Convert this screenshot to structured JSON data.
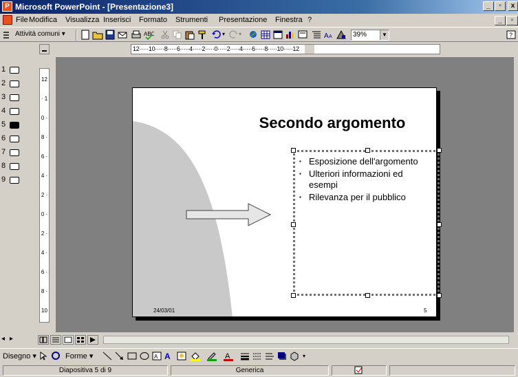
{
  "window": {
    "title": "Microsoft PowerPoint - [Presentazione3]",
    "min_label": "_",
    "max_label": "▫",
    "close_label": "x"
  },
  "menu": {
    "items": [
      "File",
      "Modifica",
      "Visualizza",
      "Inserisci",
      "Formato",
      "Strumenti",
      "Presentazione",
      "Finestra",
      "?"
    ]
  },
  "toolbar": {
    "common_tasks_label": "Attività comuni ▾",
    "zoom_value": "39%"
  },
  "outline": {
    "numbers": [
      "1",
      "2",
      "3",
      "4",
      "5",
      "6",
      "7",
      "8",
      "9"
    ]
  },
  "ruler": {
    "h_ticks": "12·····10·····8·····6·····4·····2·····0·····2·····4·····6·····8·····10·····12",
    "v_ticks": "12 · 10 · 8 · 6 · 4 · 2 · 0 · 2 · 4 · 6 · 8 · 10 · 12"
  },
  "slide": {
    "title": "Secondo argomento",
    "bullets": [
      "Esposizione dell'argomento",
      "Ulteriori informazioni ed esempi",
      "Rilevanza per il pubblico"
    ],
    "date": "24/03/01",
    "page_number": "5"
  },
  "drawbar": {
    "disegno_label": "Disegno ▾",
    "forme_label": "Forme ▾"
  },
  "statusbar": {
    "slide_indicator": "Diapositiva 5 di 9",
    "design": "Generica"
  },
  "colors": {
    "titlebar": "#0a246a",
    "workspace": "#808080",
    "chrome": "#d4d0c8",
    "slide_shape": "#c9c9c9"
  }
}
